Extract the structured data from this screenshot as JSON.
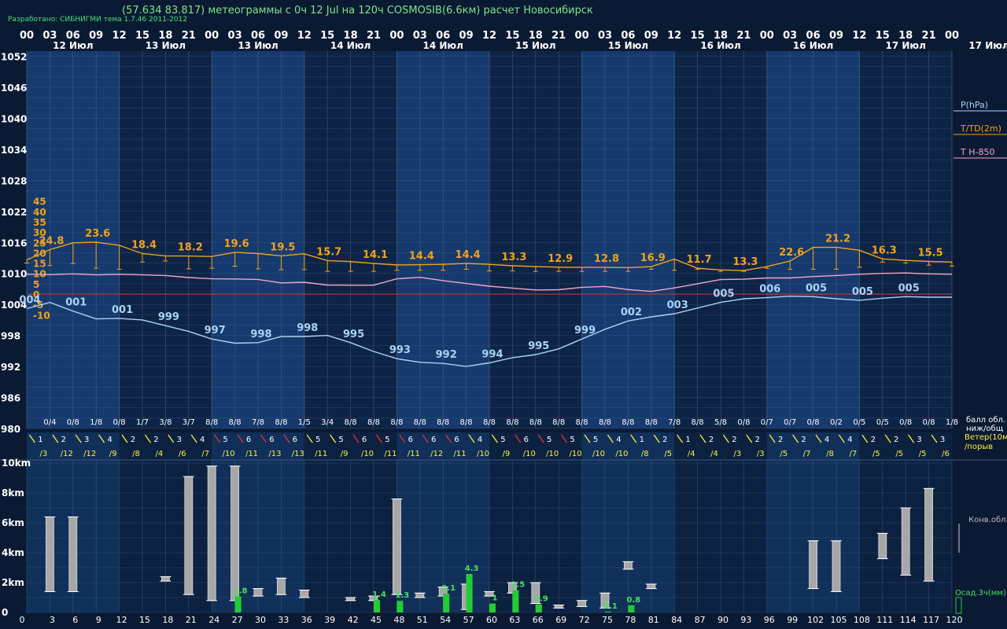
{
  "header": {
    "credit": "Разработано: СИБНИГМИ тема 1.7.46 2011-2012",
    "title": "(57.634 83.817) метеограммы с  0ч 12 Jul на 120ч COSMOSIB(6.6км) расчет Новосибирск"
  },
  "colors": {
    "background": "#0b1a33",
    "band_light": "#163a6d",
    "band_dark": "#0e2446",
    "grid": "#4a6a92",
    "temp": "#f2a21c",
    "pressure": "#a9d3f5",
    "t850": "#f2a6c8",
    "zero_line": "#b83a3a",
    "wind_yellow": "#ffee33",
    "wind_red": "#e8312b",
    "cloud_bar": "#a7a7a7",
    "precip": "#22cc33"
  },
  "chart_data": [
    {
      "type": "line",
      "x_unit": "hours",
      "x": [
        0,
        3,
        6,
        9,
        12,
        15,
        18,
        21,
        24,
        27,
        30,
        33,
        36,
        39,
        42,
        45,
        48,
        51,
        54,
        57,
        60,
        63,
        66,
        69,
        72,
        75,
        78,
        81,
        84,
        87,
        90,
        93,
        96,
        99,
        102,
        105,
        108,
        111,
        114,
        117,
        120
      ],
      "hour_ticks": [
        "00",
        "03",
        "06",
        "09",
        "12",
        "15",
        "18",
        "21",
        "00",
        "03",
        "06",
        "09",
        "12",
        "15",
        "18",
        "21",
        "00",
        "03",
        "06",
        "09",
        "12",
        "15",
        "18",
        "21",
        "00",
        "03",
        "06",
        "09",
        "12",
        "15",
        "18",
        "21",
        "00",
        "03",
        "06",
        "09",
        "12",
        "15",
        "18",
        "21",
        "00"
      ],
      "day_labels": [
        "12 Июл",
        "13 Июл",
        "13 Июл",
        "14 Июл",
        "14 Июл",
        "15 Июл",
        "15 Июл",
        "16 Июл",
        "16 Июл",
        "17 Июл"
      ],
      "right_day_label": "17 Июл",
      "pressure_ticks": [
        "1052",
        "1046",
        "1040",
        "1034",
        "1028",
        "1022",
        "1016",
        "1010",
        "1004",
        "998",
        "992",
        "986",
        "980"
      ],
      "temp_ticks": [
        "45",
        "40",
        "35",
        "30",
        "25",
        "20",
        "15",
        "10",
        "5",
        "0",
        "-5",
        "-10"
      ],
      "pressure_range": [
        980,
        1053
      ],
      "temp_range": [
        -12,
        47
      ],
      "series": [
        {
          "name": "T/TD(2m)",
          "values": [
            16.5,
            21.5,
            24.8,
            25.1,
            23.6,
            19.6,
            18.4,
            18.4,
            18.2,
            20.2,
            19.6,
            18.5,
            19.5,
            16.2,
            15.7,
            14.8,
            14.1,
            14.2,
            14.4,
            14.8,
            14.4,
            13.7,
            13.3,
            13.0,
            12.9,
            12.9,
            12.8,
            13.3,
            16.9,
            12.5,
            11.7,
            11.4,
            13.3,
            16.0,
            22.6,
            22.6,
            21.2,
            17.0,
            16.3,
            15.8,
            15.5
          ]
        },
        {
          "name": "TD",
          "values": [
            15.0,
            13.8,
            14.8,
            12.5,
            12.0,
            15.5,
            16.0,
            12.2,
            12.5,
            13.5,
            12.2,
            11.8,
            11.8,
            11.0,
            11.0,
            11.0,
            11.5,
            11.5,
            11.5,
            12.0,
            11.2,
            11.2,
            11.0,
            11.0,
            11.0,
            11.0,
            11.0,
            12.0,
            11.5,
            12.0,
            11.0,
            11.0,
            12.5,
            12.0,
            12.0,
            12.0,
            13.0,
            15.5,
            15.0,
            14.0,
            13.5
          ]
        },
        {
          "name": "P(hPa)",
          "values": [
            1003.2,
            1004.4,
            1002.7,
            1001.2,
            1001.3,
            1001.0,
            999.9,
            998.8,
            997.3,
            996.5,
            996.6,
            997.8,
            997.8,
            998.0,
            996.6,
            994.9,
            993.5,
            992.8,
            992.6,
            992.0,
            992.7,
            993.7,
            994.3,
            995.4,
            997.3,
            999.2,
            1000.8,
            1001.6,
            1002.2,
            1003.3,
            1004.4,
            1005.1,
            1005.3,
            1005.6,
            1005.5,
            1005.1,
            1004.8,
            1005.2,
            1005.5,
            1005.4,
            1005.4
          ]
        },
        {
          "name": "T H-850",
          "values": [
            9.6,
            9.4,
            9.8,
            9.3,
            9.6,
            9.3,
            9.0,
            8.0,
            7.4,
            7.3,
            7.1,
            5.4,
            5.7,
            4.4,
            4.3,
            4.3,
            7.4,
            8.1,
            6.5,
            5.1,
            3.8,
            2.9,
            2.0,
            2.1,
            3.3,
            3.7,
            2.2,
            1.3,
            3.0,
            5.0,
            7.0,
            7.2,
            7.8,
            7.8,
            8.5,
            9.0,
            9.6,
            10.0,
            10.2,
            9.8,
            9.6
          ]
        }
      ],
      "temp_labels": [
        {
          "x": 9,
          "text": "24.8"
        },
        {
          "x": 15,
          "text": "23.6"
        },
        {
          "x": 21,
          "text": "18.4"
        },
        {
          "x": 27,
          "text": "18.2"
        },
        {
          "x": 33,
          "text": "19.6"
        },
        {
          "x": 39,
          "text": "19.5"
        },
        {
          "x": 45,
          "text": "15.7"
        },
        {
          "x": 51,
          "text": "14.1"
        },
        {
          "x": 57,
          "text": "14.4"
        },
        {
          "x": 63,
          "text": "14.4"
        },
        {
          "x": 69,
          "text": "13.3"
        },
        {
          "x": 75,
          "text": "12.9"
        },
        {
          "x": 81,
          "text": "12.8"
        },
        {
          "x": 87,
          "text": "16.9"
        },
        {
          "x": 93,
          "text": "11.7"
        },
        {
          "x": 99,
          "text": "13.3"
        },
        {
          "x": 105,
          "text": "22.6"
        },
        {
          "x": 111,
          "text": "21.2"
        },
        {
          "x": 117,
          "text": "16.3"
        },
        {
          "x": 123,
          "text": "15.5"
        }
      ],
      "pressure_labels": [
        {
          "x": 3,
          "text": "004"
        },
        {
          "x": 9,
          "text": "001"
        },
        {
          "x": 15,
          "text": "001"
        },
        {
          "x": 21,
          "text": "999"
        },
        {
          "x": 27,
          "text": "997"
        },
        {
          "x": 33,
          "text": "998"
        },
        {
          "x": 39,
          "text": "998"
        },
        {
          "x": 45,
          "text": "995"
        },
        {
          "x": 51,
          "text": "993"
        },
        {
          "x": 57,
          "text": "992"
        },
        {
          "x": 63,
          "text": "994"
        },
        {
          "x": 69,
          "text": "995"
        },
        {
          "x": 75,
          "text": "999"
        },
        {
          "x": 81,
          "text": "002"
        },
        {
          "x": 87,
          "text": "003"
        },
        {
          "x": 93,
          "text": "005"
        },
        {
          "x": 99,
          "text": "006"
        },
        {
          "x": 105,
          "text": "005"
        },
        {
          "x": 111,
          "text": "005"
        },
        {
          "x": 117,
          "text": "005"
        }
      ],
      "cloud_cover": [
        "0/4",
        "0/8",
        "1/8",
        "0/8",
        "1/7",
        "3/8",
        "3/7",
        "8/8",
        "8/8",
        "7/8",
        "8/8",
        "1/5",
        "3/4",
        "8/8",
        "8/8",
        "8/8",
        "8/8",
        "8/8",
        "8/8",
        "8/8",
        "8/8",
        "8/8",
        "8/8",
        "8/8",
        "8/8",
        "8/8",
        "8/8",
        "7/8",
        "8/8",
        "5/8",
        "0/8",
        "0/7",
        "0/7",
        "0/8",
        "0/2",
        "0/5",
        "0/5",
        "0/8",
        "0/8",
        "1/8"
      ],
      "legend": {
        "pressure": "P(hPa)",
        "temp": "T/TD(2m)",
        "t850": "T H-850",
        "cloud_cover": [
          "балл обл.",
          "ниж/общ"
        ],
        "wind": [
          "Ветер(10м)",
          "/порыв"
        ]
      }
    },
    {
      "type": "bar",
      "name": "wind",
      "x": [
        3,
        6,
        9,
        12,
        15,
        18,
        21,
        24,
        27,
        30,
        33,
        36,
        39,
        42,
        45,
        48,
        51,
        54,
        57,
        60,
        63,
        66,
        69,
        72,
        75,
        78,
        81,
        84,
        87,
        90,
        93,
        96,
        99,
        102,
        105,
        108,
        111,
        114,
        117,
        120
      ],
      "speed": [
        "1",
        "2",
        "3",
        "4",
        "2",
        "2",
        "3",
        "4",
        "5",
        "6",
        "6",
        "6",
        "5",
        "5",
        "6",
        "5",
        "6",
        "6",
        "6",
        "4",
        "5",
        "6",
        "5",
        "5",
        "5",
        "4",
        "1",
        "2",
        "1",
        "2",
        "2",
        "2",
        "2",
        "2",
        "4",
        "4",
        "2",
        "2",
        "3",
        "3",
        "3"
      ],
      "gust": [
        "/3",
        "/12",
        "/12",
        "/9",
        "/8",
        "/4",
        "/6",
        "/7",
        "/10",
        "/11",
        "/13",
        "/13",
        "/11",
        "/9",
        "/10",
        "/11",
        "/11",
        "/12",
        "/11",
        "/10",
        "/9",
        "/10",
        "/10",
        "/10",
        "/10",
        "/10",
        "/8",
        "/5",
        "/4",
        "/4",
        "/3",
        "/3",
        "/5",
        "/7",
        "/8",
        "/7",
        "/5",
        "/5",
        "/5",
        "/6"
      ],
      "strong": [
        false,
        false,
        false,
        false,
        false,
        false,
        false,
        false,
        true,
        true,
        true,
        true,
        false,
        false,
        true,
        true,
        true,
        true,
        true,
        false,
        false,
        true,
        true,
        true,
        false,
        false,
        false,
        false,
        false,
        false,
        false,
        false,
        false,
        false,
        false,
        false,
        false,
        false,
        false,
        false
      ]
    },
    {
      "type": "bar",
      "name": "Конв.обл.",
      "height_ticks": [
        "10km",
        "8km",
        "6km",
        "4km",
        "2km",
        "0"
      ],
      "x_ticks": [
        "3",
        "6",
        "9",
        "12",
        "15",
        "18",
        "21",
        "24",
        "27",
        "30",
        "33",
        "36",
        "39",
        "42",
        "45",
        "48",
        "51",
        "54",
        "57",
        "60",
        "63",
        "66",
        "69",
        "72",
        "75",
        "78",
        "81",
        "84",
        "87",
        "90",
        "93",
        "96",
        "99",
        "102",
        "105",
        "108",
        "111",
        "114",
        "117",
        "120"
      ],
      "clouds_km": [
        {
          "x": 6,
          "base": 1.4,
          "top": 6.4
        },
        {
          "x": 9,
          "base": 1.4,
          "top": 6.4
        },
        {
          "x": 21,
          "base": 2.1,
          "top": 2.4
        },
        {
          "x": 24,
          "base": 1.2,
          "top": 9.1
        },
        {
          "x": 27,
          "base": 0.8,
          "top": 9.8
        },
        {
          "x": 30,
          "base": 0.8,
          "top": 9.8
        },
        {
          "x": 33,
          "base": 1.1,
          "top": 1.6
        },
        {
          "x": 36,
          "base": 1.2,
          "top": 2.3
        },
        {
          "x": 39,
          "base": 1.0,
          "top": 1.5
        },
        {
          "x": 45,
          "base": 0.8,
          "top": 1.0
        },
        {
          "x": 48,
          "base": 0.8,
          "top": 1.1
        },
        {
          "x": 51,
          "base": 1.2,
          "top": 7.6
        },
        {
          "x": 54,
          "base": 1.0,
          "top": 1.3
        },
        {
          "x": 57,
          "base": 1.1,
          "top": 1.7
        },
        {
          "x": 60,
          "base": 0.2,
          "top": 1.9
        },
        {
          "x": 63,
          "base": 1.1,
          "top": 1.4
        },
        {
          "x": 66,
          "base": 1.3,
          "top": 2.0
        },
        {
          "x": 69,
          "base": 0.6,
          "top": 2.0
        },
        {
          "x": 72,
          "base": 0.3,
          "top": 0.5
        },
        {
          "x": 75,
          "base": 0.4,
          "top": 0.8
        },
        {
          "x": 78,
          "base": 0.3,
          "top": 1.3
        },
        {
          "x": 81,
          "base": 2.9,
          "top": 3.4
        },
        {
          "x": 84,
          "base": 1.6,
          "top": 1.9
        },
        {
          "x": 105,
          "base": 1.6,
          "top": 4.8
        },
        {
          "x": 108,
          "base": 1.4,
          "top": 4.8
        },
        {
          "x": 114,
          "base": 3.6,
          "top": 5.3
        },
        {
          "x": 117,
          "base": 2.5,
          "top": 7.0
        },
        {
          "x": 120,
          "base": 2.1,
          "top": 8.3
        }
      ],
      "precip_label": "Осад.3ч(мм)",
      "precip": [
        {
          "x": 30,
          "value": 1.8,
          "label": "1.8"
        },
        {
          "x": 48,
          "value": 1.4,
          "label": "1.4"
        },
        {
          "x": 51,
          "value": 1.3,
          "label": "1.3"
        },
        {
          "x": 57,
          "value": 2.1,
          "label": "2.1"
        },
        {
          "x": 60,
          "value": 4.3,
          "label": "4.3"
        },
        {
          "x": 63,
          "value": 1.0,
          "label": "1"
        },
        {
          "x": 66,
          "value": 2.5,
          "label": "2.5"
        },
        {
          "x": 69,
          "value": 0.9,
          "label": "0.9"
        },
        {
          "x": 78,
          "value": 0.1,
          "label": "0.1"
        },
        {
          "x": 81,
          "value": 0.8,
          "label": "0.8"
        }
      ]
    }
  ]
}
